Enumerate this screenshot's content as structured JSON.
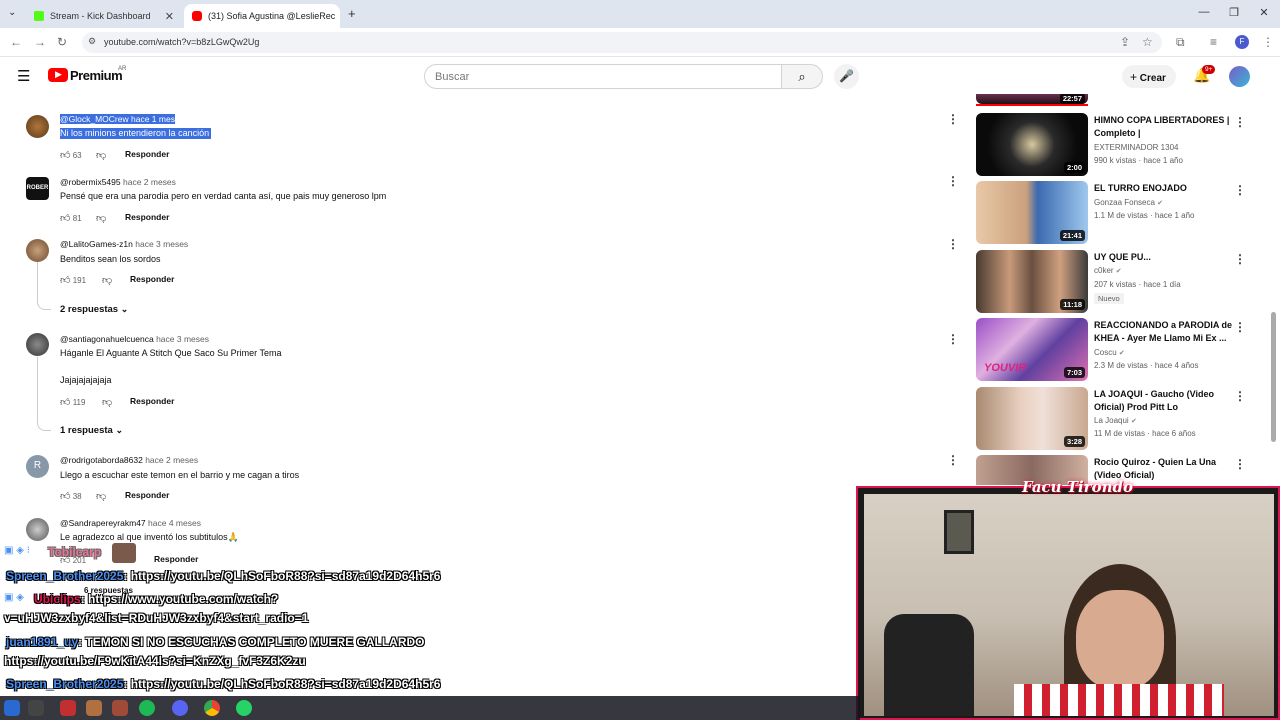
{
  "browser": {
    "tabs": [
      {
        "label": "Stream - Kick Dashboard",
        "color": "#53fc18"
      },
      {
        "label": "(31) Sofia Agustina @LeslieRec",
        "color": "#ff0000"
      }
    ],
    "url": "youtube.com/watch?v=b8zLGwQw2Ug"
  },
  "youtube": {
    "brand": "Premium",
    "region": "AR",
    "search_placeholder": "Buscar",
    "create_label": "Crear",
    "notif_count": "9+"
  },
  "comments": [
    {
      "user": "@Glock_MOCrew",
      "time": "hace 1 mes",
      "text": "Ni los minions entendieron la canción",
      "likes": "63",
      "reply": "Responder"
    },
    {
      "user": "@robermix5495",
      "time": "hace 2 meses",
      "text": "Pensé que era una parodia pero en verdad canta así, que pais muy generoso lpm",
      "likes": "81",
      "reply": "Responder"
    },
    {
      "user": "@LalitoGames-z1n",
      "time": "hace 3 meses",
      "text": "Benditos sean los sordos",
      "likes": "191",
      "reply": "Responder",
      "replies": "2 respuestas"
    },
    {
      "user": "@santiagonahuelcuenca",
      "time": "hace 3 meses",
      "text": "Háganle El Aguante A Stitch Que Saco Su Primer Tema",
      "text2": "Jajajajajajaja",
      "likes": "119",
      "reply": "Responder",
      "replies": "1 respuesta"
    },
    {
      "user": "@rodrigotaborda8632",
      "time": "hace 2 meses",
      "text": "Llego a escuchar este temon en el barrio y me cagan a tiros",
      "likes": "38",
      "reply": "Responder",
      "avatar_letter": "R"
    },
    {
      "user": "@Sandrapereyrakm47",
      "time": "hace 4 meses",
      "text": "Le agradezco al que inventó los subtitulos🙏",
      "likes": "201",
      "reply": "Responder",
      "replies": "6 respuestas"
    }
  ],
  "sidebar": [
    {
      "title": "",
      "channel": "",
      "meta": "",
      "duration": "22:57"
    },
    {
      "title": "HIMNO COPA LIBERTADORES | Completo |",
      "channel": "EXTERMINADOR 1304",
      "meta": "990 k vistas · hace 1 año",
      "duration": "2:00"
    },
    {
      "title": "EL TURRO ENOJADO",
      "channel": "Gonzaa Fonseca",
      "meta": "1.1 M de vistas · hace 1 año",
      "duration": "21:41"
    },
    {
      "title": "UY QUE PU...",
      "channel": "c0ker",
      "meta": "207 k vistas · hace 1 día",
      "duration": "11:18",
      "badge": "Nuevo"
    },
    {
      "title": "REACCIONANDO a PARODIA de KHEA - Ayer Me Llamo Mi Ex ...",
      "channel": "Coscu",
      "meta": "2.3 M de vistas · hace 4 años",
      "duration": "7:03"
    },
    {
      "title": "LA JOAQUI - Gaucho (Video Oficial) Prod Pitt Lo",
      "channel": "La Joaqui",
      "meta": "11 M de vistas · hace 6 años",
      "duration": "3:28"
    },
    {
      "title": "Rocio Quiroz - Quien La Una (Video Oficial)",
      "channel": "",
      "meta": "",
      "duration": ""
    }
  ],
  "chat": [
    {
      "user": "Tobilcarp",
      "text": "",
      "user_color": "#e0154f"
    },
    {
      "user": "Spreen_Brother2025",
      "text": ": https://youtu.be/QLhSoFboR88?si=sd87a19d2D64h5r6",
      "user_color": "#4b8ff0"
    },
    {
      "user": "Ubiclips",
      "text": ": https://www.youtube.com/watch?",
      "user_color": "#e0154f"
    },
    {
      "user": "",
      "text": "v=uHJW3zxbyf4&list=RDuHJW3zxbyf4&start_radio=1",
      "user_color": "#fff"
    },
    {
      "user": "juan1891_uy",
      "text": ": TEMON SI NO ESCUCHAS COMPLETO MUERE GALLARDO",
      "user_color": "#4b8ff0"
    },
    {
      "user": "",
      "text": "https://youtu.be/F9wKitA44ls?si=KnZXg_fvF3Z6K2zu",
      "user_color": "#fff"
    },
    {
      "user": "Spreen_Brother2025",
      "text": ": https://youtu.be/QLhSoFboR88?si=sd87a19d2D64h5r6",
      "user_color": "#4b8ff0"
    },
    {
      "user": "Tobilcarp",
      "text": "",
      "user_color": "#e0154f"
    }
  ],
  "webcam": {
    "name": "Facu Tirondo"
  }
}
